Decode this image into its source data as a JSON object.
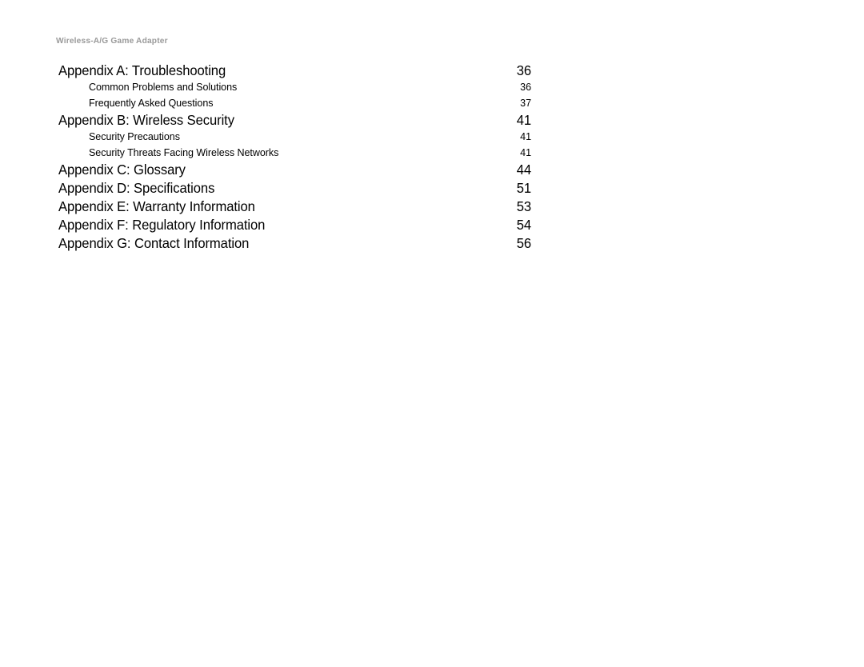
{
  "page": {
    "running_header": "Wireless-A/G Game Adapter",
    "background_color": "#ffffff",
    "text_color": "#000000",
    "header_color": "#9a9a9a"
  },
  "toc": {
    "entries": [
      {
        "level": 1,
        "title": "Appendix A: Troubleshooting",
        "page": "36"
      },
      {
        "level": 2,
        "title": "Common Problems and Solutions",
        "page": "36"
      },
      {
        "level": 2,
        "title": "Frequently Asked Questions",
        "page": "37"
      },
      {
        "level": 1,
        "title": "Appendix B: Wireless Security",
        "page": "41"
      },
      {
        "level": 2,
        "title": "Security Precautions",
        "page": "41"
      },
      {
        "level": 2,
        "title": "Security Threats Facing Wireless Networks",
        "page": "41"
      },
      {
        "level": 1,
        "title": "Appendix C: Glossary",
        "page": "44"
      },
      {
        "level": 1,
        "title": "Appendix D: Specifications",
        "page": "51"
      },
      {
        "level": 1,
        "title": "Appendix E: Warranty Information",
        "page": "53"
      },
      {
        "level": 1,
        "title": "Appendix F: Regulatory Information",
        "page": "54"
      },
      {
        "level": 1,
        "title": "Appendix G: Contact Information",
        "page": "56"
      }
    ]
  }
}
